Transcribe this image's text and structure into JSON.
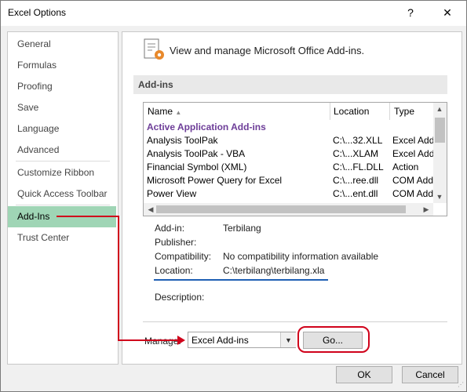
{
  "window": {
    "title": "Excel Options",
    "help_label": "?",
    "close_label": "✕"
  },
  "sidebar": {
    "items": [
      {
        "label": "General"
      },
      {
        "label": "Formulas"
      },
      {
        "label": "Proofing"
      },
      {
        "label": "Save"
      },
      {
        "label": "Language"
      },
      {
        "label": "Advanced"
      },
      {
        "label": "Customize Ribbon"
      },
      {
        "label": "Quick Access Toolbar"
      },
      {
        "label": "Add-Ins",
        "active": true
      },
      {
        "label": "Trust Center"
      }
    ]
  },
  "main": {
    "header": "View and manage Microsoft Office Add-ins.",
    "section_label": "Add-ins",
    "table": {
      "columns": [
        "Name",
        "Location",
        "Type"
      ],
      "sort_indicator": "▲",
      "group_label": "Active Application Add-ins",
      "rows": [
        {
          "name": "Analysis ToolPak",
          "location": "C:\\...32.XLL",
          "type": "Excel Add"
        },
        {
          "name": "Analysis ToolPak - VBA",
          "location": "C:\\...XLAM",
          "type": "Excel Add"
        },
        {
          "name": "Financial Symbol (XML)",
          "location": "C:\\...FL.DLL",
          "type": "Action"
        },
        {
          "name": "Microsoft Power Query for Excel",
          "location": "C:\\...ree.dll",
          "type": "COM Add"
        },
        {
          "name": "Power View",
          "location": "C:\\...ent.dll",
          "type": "COM Add"
        }
      ]
    },
    "details": {
      "addin_label": "Add-in:",
      "addin_value": "Terbilang",
      "publisher_label": "Publisher:",
      "publisher_value": "",
      "compat_label": "Compatibility:",
      "compat_value": "No compatibility information available",
      "location_label": "Location:",
      "location_value": "C:\\terbilang\\terbilang.xla",
      "description_label": "Description:",
      "description_value": ""
    },
    "manage": {
      "label": "Manage:",
      "selected": "Excel Add-ins",
      "go_label": "Go..."
    }
  },
  "footer": {
    "ok_label": "OK",
    "cancel_label": "Cancel"
  },
  "colors": {
    "active_nav": "#9fd5b5",
    "annotation_red": "#d0021b",
    "annotation_blue": "#1f5fb4",
    "group_purple": "#6d3d98"
  }
}
